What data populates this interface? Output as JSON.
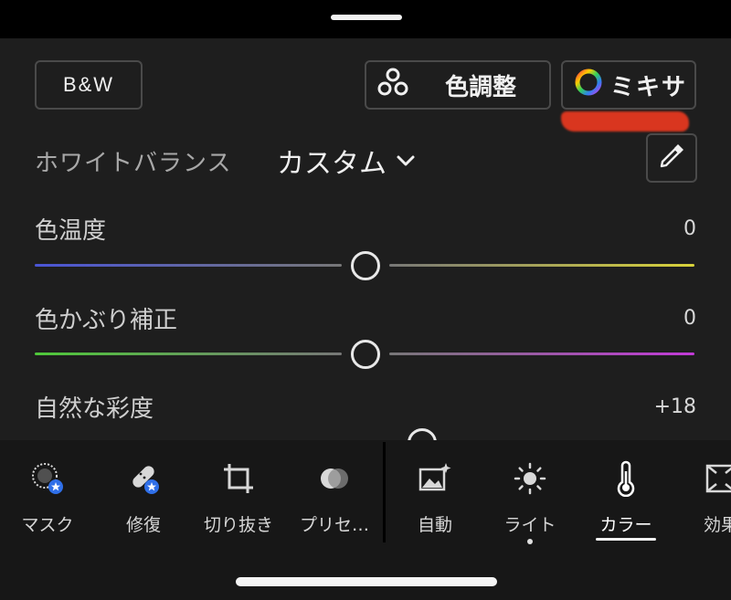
{
  "toolbar": {
    "bw_label": "B&W",
    "color_adjust_label": "色調整",
    "mixer_label": "ミキサ"
  },
  "white_balance": {
    "label": "ホワイトバランス",
    "value": "カスタム"
  },
  "sliders": [
    {
      "label": "色温度",
      "value": "0",
      "position": 0.5
    },
    {
      "label": "色かぶり補正",
      "value": "0",
      "position": 0.5
    },
    {
      "label": "自然な彩度",
      "value": "+18",
      "position": 0.59
    }
  ],
  "tools": [
    {
      "label": "マスク",
      "icon": "mask-icon"
    },
    {
      "label": "修復",
      "icon": "healing-bandage-icon"
    },
    {
      "label": "切り抜き",
      "icon": "crop-icon"
    },
    {
      "label": "プリセ…",
      "icon": "presets-icon"
    },
    {
      "label": "自動",
      "icon": "auto-image-icon"
    },
    {
      "label": "ライト",
      "icon": "sun-icon"
    },
    {
      "label": "カラー",
      "icon": "thermometer-icon"
    },
    {
      "label": "効果",
      "icon": "effects-icon"
    }
  ],
  "colors": {
    "background": "#1e1e1e",
    "bottom_bar": "#171717",
    "accent_red": "#d9361f",
    "temp_left": "#4a55d6",
    "temp_right": "#d8d23a",
    "tint_left": "#4fc93a",
    "tint_right": "#c23ad8",
    "badge_blue": "#2f6fe8"
  }
}
